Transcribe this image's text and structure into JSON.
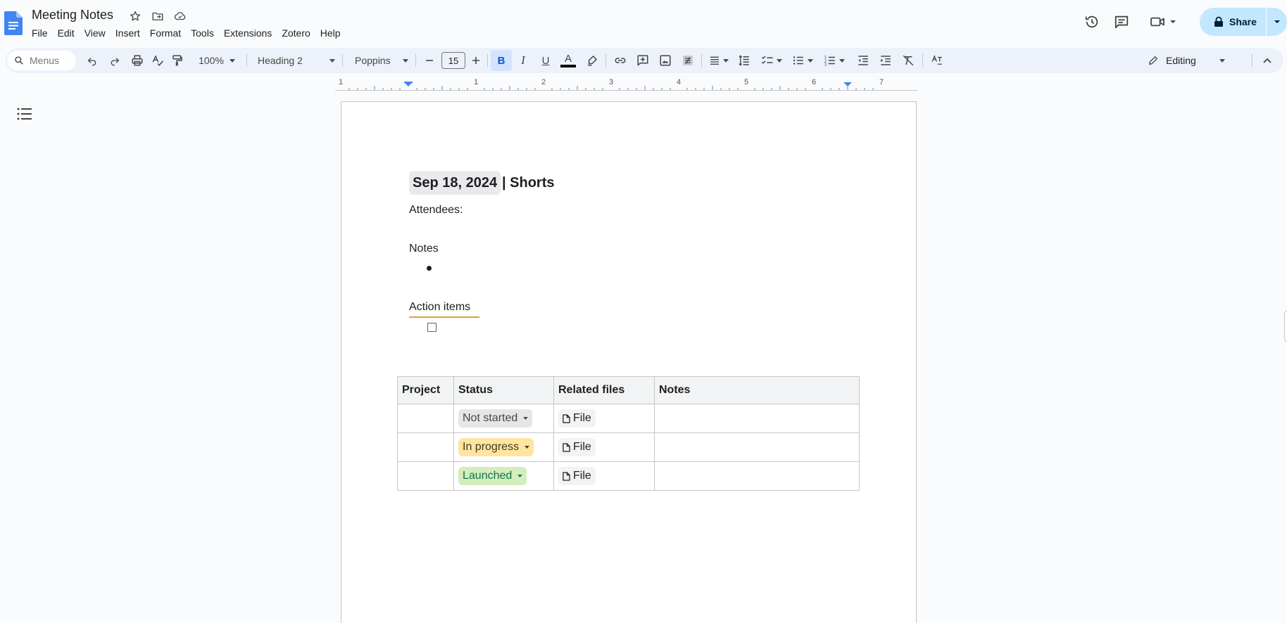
{
  "header": {
    "title": "Meeting Notes",
    "menu": [
      "File",
      "Edit",
      "View",
      "Insert",
      "Format",
      "Tools",
      "Extensions",
      "Zotero",
      "Help"
    ],
    "share_label": "Share"
  },
  "toolbar": {
    "search_placeholder": "Menus",
    "zoom": "100%",
    "style": "Heading 2",
    "font": "Poppins",
    "font_size": "15",
    "mode": "Editing"
  },
  "ruler": {
    "marks": [
      "1",
      "1",
      "2",
      "3",
      "4",
      "5",
      "6",
      "7"
    ]
  },
  "document": {
    "heading_date": "Sep 18, 2024",
    "heading_rest": "| Shorts",
    "attendees_label": "Attendees:",
    "notes_label": "Notes",
    "action_items_label": "Action items",
    "table": {
      "headers": [
        "Project",
        "Status",
        "Related files",
        "Notes"
      ],
      "rows": [
        {
          "project": "",
          "status": "Not started",
          "file": "File",
          "notes": ""
        },
        {
          "project": "",
          "status": "In progress",
          "file": "File",
          "notes": ""
        },
        {
          "project": "",
          "status": "Launched",
          "file": "File",
          "notes": ""
        }
      ]
    }
  },
  "colors": {
    "accent": "#0b57d0",
    "share_bg": "#c2e7ff",
    "not_started_bg": "#e6e6e6",
    "in_progress_bg": "#ffe5a0",
    "in_progress_text": "#473821",
    "launched_bg": "#d4edbc",
    "launched_text": "#11734b"
  }
}
